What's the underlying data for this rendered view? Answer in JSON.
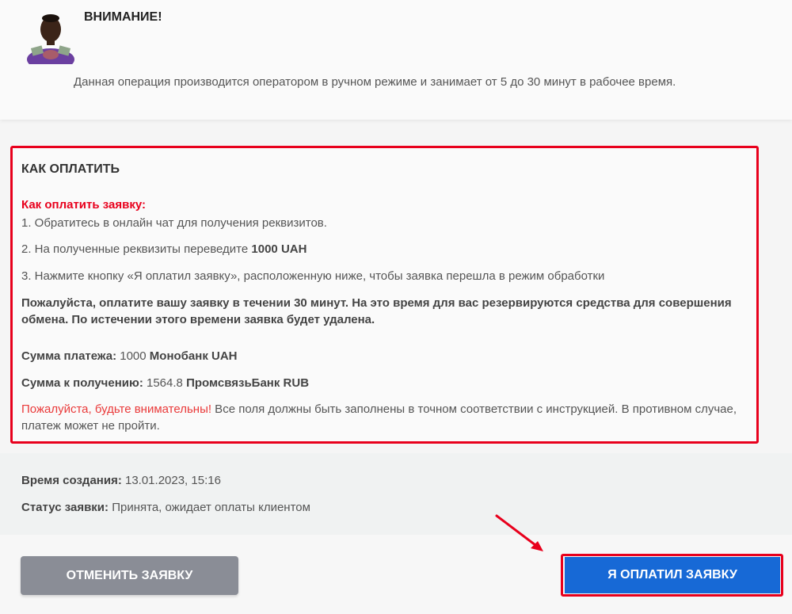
{
  "notice": {
    "title": "ВНИМАНИЕ!",
    "text": "Данная операция производится оператором в ручном режиме и занимает от 5 до 30 минут в рабочее время."
  },
  "howto": {
    "heading": "КАК ОПЛАТИТЬ",
    "subheading": "Как оплатить заявку:",
    "step1": "1. Обратитесь в онлайн чат для получения реквизитов.",
    "step2_prefix": "2. На полученные реквизиты переведите ",
    "step2_amount": "1000 UAH",
    "step3": "3. Нажмите кнопку «Я оплатил заявку», расположенную ниже, чтобы заявка перешла в режим обработки",
    "note": "Пожалуйста, оплатите вашу заявку в течении 30 минут. На это время для вас резервируются средства для совершения обмена. По истечении этого времени заявка будет удалена.",
    "pay_label": "Сумма платежа:",
    "pay_amount": "1000",
    "pay_currency": "Монобанк UAH",
    "receive_label": "Сумма к получению:",
    "receive_amount": "1564.8",
    "receive_currency": "ПромсвязьБанк RUB",
    "warning_red": "Пожалуйста, будьте внимательны!",
    "warning_text": " Все поля должны быть заполнены в точном соответствии с инструкцией. В противном случае, платеж может не пройти."
  },
  "info": {
    "created_label": "Время создания:",
    "created_value": "13.01.2023, 15:16",
    "status_label": "Статус заявки:",
    "status_value": "Принята, ожидает оплаты клиентом"
  },
  "buttons": {
    "cancel": "ОТМЕНИТЬ ЗАЯВКУ",
    "paid": "Я ОПЛАТИЛ ЗАЯВКУ"
  },
  "colors": {
    "highlight_red": "#e8001c",
    "primary_blue": "#1769d6",
    "cancel_gray": "#8a8d96"
  }
}
